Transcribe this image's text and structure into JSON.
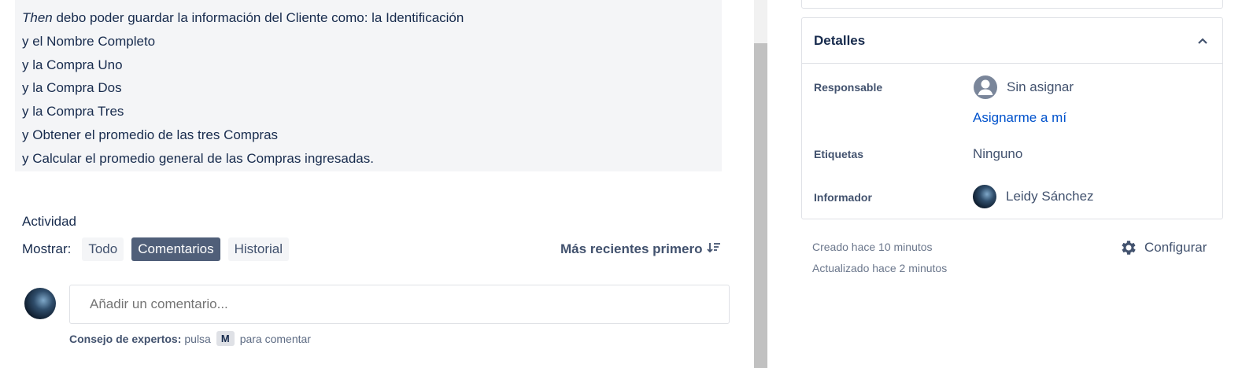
{
  "description": {
    "first_line_italic": "Then",
    "first_line_rest": " debo poder guardar la información del Cliente como: la Identificación",
    "lines": [
      "y el Nombre Completo",
      "y la Compra Uno",
      "y la Compra Dos",
      "y la Compra Tres",
      "y Obtener el promedio de las tres Compras",
      "y Calcular el promedio general de las Compras ingresadas."
    ]
  },
  "activity": {
    "title": "Actividad",
    "show_label": "Mostrar:",
    "filters": [
      "Todo",
      "Comentarios",
      "Historial"
    ],
    "active_filter": "Comentarios",
    "sort_label": "Más recientes primero",
    "comment_placeholder": "Añadir un comentario...",
    "tip_bold": "Consejo de expertos:",
    "tip_pre": "pulsa",
    "tip_key": "M",
    "tip_post": "para comentar"
  },
  "details": {
    "title": "Detalles",
    "assignee_label": "Responsable",
    "assignee_value": "Sin asignar",
    "assign_me": "Asignarme a mí",
    "labels_label": "Etiquetas",
    "labels_value": "Ninguno",
    "reporter_label": "Informador",
    "reporter_value": "Leidy Sánchez"
  },
  "meta": {
    "created": "Creado hace 10 minutos",
    "updated": "Actualizado hace 2 minutos",
    "configure": "Configurar"
  },
  "colors": {
    "active_chip": "#505f79",
    "link": "#0052cc",
    "description_bg": "#f4f5f7"
  },
  "icons": [
    "sort-icon",
    "chevron-up-icon",
    "user-placeholder-icon",
    "gear-icon"
  ]
}
